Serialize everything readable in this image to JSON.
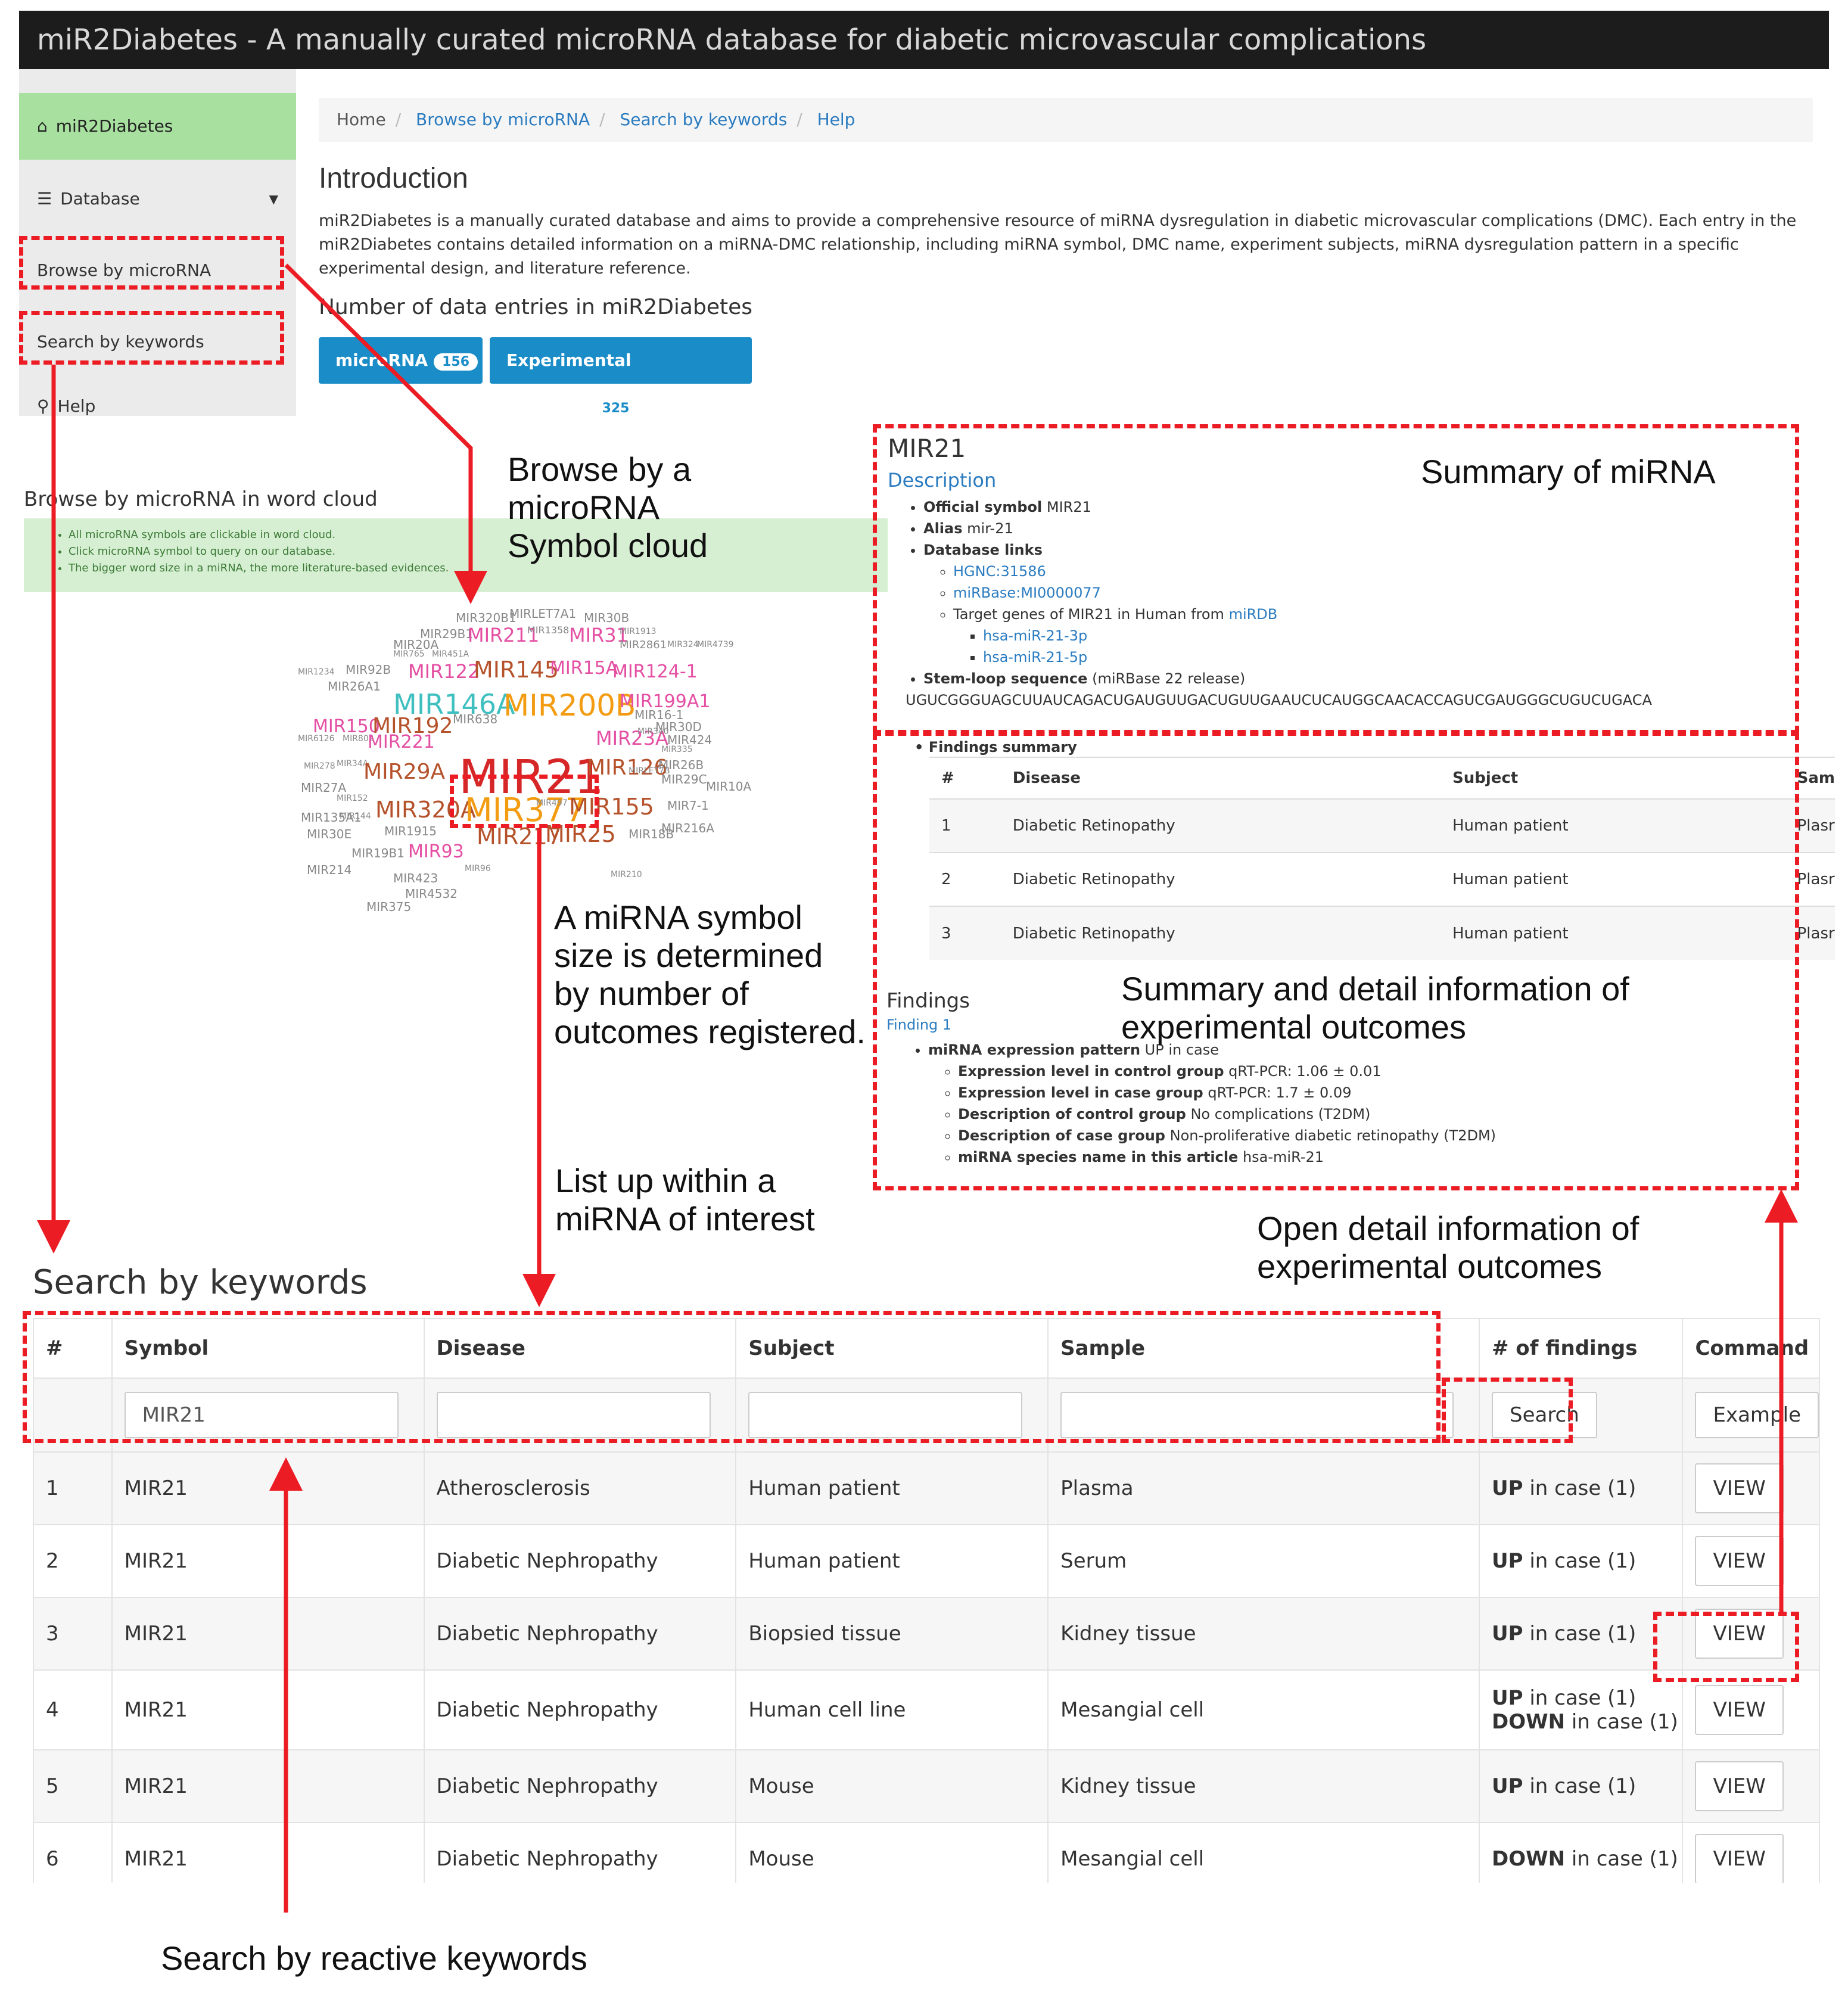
{
  "app_title": "miR2Diabetes - A manually curated microRNA database for diabetic microvascular complications",
  "sidebar": {
    "home_label": "miR2Diabetes",
    "database_label": "Database",
    "browse_label": "Browse by microRNA",
    "search_label": "Search by keywords",
    "help_label": "Help"
  },
  "breadcrumb": [
    "Home",
    "Browse by microRNA",
    "Search by keywords",
    "Help"
  ],
  "intro": {
    "heading": "Introduction",
    "text": "miR2Diabetes is a manually curated database and aims to provide a comprehensive resource of miRNA dysregulation in diabetic microvascular complications (DMC). Each entry in the miR2Diabetes contains detailed information on a miRNA-DMC relationship, including miRNA symbol, DMC name, experiment subjects, miRNA dysregulation pattern in a specific experimental design, and literature reference.",
    "count_heading": "Number of data entries in miR2Diabetes",
    "btn_microrna": "microRNA",
    "btn_microrna_count": "156",
    "btn_outcome": "Experimental outcome",
    "btn_outcome_count": "325"
  },
  "cloud": {
    "heading": "Browse by microRNA in word cloud",
    "notes": [
      "All microRNA symbols are clickable in word cloud.",
      "Click microRNA symbol to query on our database.",
      "The bigger word size in a miRNA, the more literature-based evidences."
    ],
    "words": [
      {
        "t": "MIR320B1",
        "c": "#888"
      },
      {
        "t": "MIRLET7A1",
        "c": "#888"
      },
      {
        "t": "MIR30B",
        "c": "#888"
      },
      {
        "t": "MIR29B1",
        "c": "#888"
      },
      {
        "t": "MIR211",
        "c": "#e44fa3"
      },
      {
        "t": "MIR1358",
        "c": "#888"
      },
      {
        "t": "MIR31",
        "c": "#e44fa3"
      },
      {
        "t": "MIR1913",
        "c": "#888"
      },
      {
        "t": "MIR20A",
        "c": "#888"
      },
      {
        "t": "MIR2861",
        "c": "#888"
      },
      {
        "t": "MIR324",
        "c": "#888"
      },
      {
        "t": "MIR4739",
        "c": "#888"
      },
      {
        "t": "MIR765",
        "c": "#888"
      },
      {
        "t": "MIR451A",
        "c": "#888"
      },
      {
        "t": "MIR1234",
        "c": "#888"
      },
      {
        "t": "MIR92B",
        "c": "#888"
      },
      {
        "t": "MIR122",
        "c": "#e44fa3"
      },
      {
        "t": "MIR145",
        "c": "#b5522b"
      },
      {
        "t": "MIR15A",
        "c": "#e44fa3"
      },
      {
        "t": "MIR124-1",
        "c": "#e44fa3"
      },
      {
        "t": "MIR26A1",
        "c": "#888"
      },
      {
        "t": "MIR146A",
        "c": "#3fbfbf"
      },
      {
        "t": "MIR200B",
        "c": "#f39c12"
      },
      {
        "t": "MIR199A1",
        "c": "#e44fa3"
      },
      {
        "t": "MIR16-1",
        "c": "#888"
      },
      {
        "t": "MIR150",
        "c": "#e44fa3"
      },
      {
        "t": "MIR192",
        "c": "#b5522b"
      },
      {
        "t": "MIR638",
        "c": "#888"
      },
      {
        "t": "MIR30D",
        "c": "#888"
      },
      {
        "t": "MIR6126",
        "c": "#888"
      },
      {
        "t": "MIR802",
        "c": "#888"
      },
      {
        "t": "MIR221",
        "c": "#e44fa3"
      },
      {
        "t": "MIR23A",
        "c": "#e44fa3"
      },
      {
        "t": "MIR340",
        "c": "#888"
      },
      {
        "t": "MIR424",
        "c": "#888"
      },
      {
        "t": "MIR21",
        "c": "#d62728"
      },
      {
        "t": "MIR126",
        "c": "#b5522b"
      },
      {
        "t": "MIR335",
        "c": "#888"
      },
      {
        "t": "MIR278",
        "c": "#888"
      },
      {
        "t": "MIR34A",
        "c": "#888"
      },
      {
        "t": "MIR29A",
        "c": "#b5522b"
      },
      {
        "t": "MIR26B",
        "c": "#888"
      },
      {
        "t": "MIRLET7B",
        "c": "#888"
      },
      {
        "t": "MIR29C",
        "c": "#888"
      },
      {
        "t": "MIR27A",
        "c": "#888"
      },
      {
        "t": "MIR10A",
        "c": "#888"
      },
      {
        "t": "MIR152",
        "c": "#888"
      },
      {
        "t": "MIR320A",
        "c": "#b5522b"
      },
      {
        "t": "MIR377",
        "c": "#f39c12"
      },
      {
        "t": "MIR497",
        "c": "#888"
      },
      {
        "t": "MIR155",
        "c": "#b5522b"
      },
      {
        "t": "MIR7-1",
        "c": "#888"
      },
      {
        "t": "MIR135A1",
        "c": "#888"
      },
      {
        "t": "MIR144",
        "c": "#888"
      },
      {
        "t": "MIR30E",
        "c": "#888"
      },
      {
        "t": "MIR1915",
        "c": "#888"
      },
      {
        "t": "MIR217",
        "c": "#b5522b"
      },
      {
        "t": "MIR25",
        "c": "#b5522b"
      },
      {
        "t": "MIR18B",
        "c": "#888"
      },
      {
        "t": "MIR216A",
        "c": "#888"
      },
      {
        "t": "MIR19B1",
        "c": "#888"
      },
      {
        "t": "MIR93",
        "c": "#e44fa3"
      },
      {
        "t": "MIR214",
        "c": "#888"
      },
      {
        "t": "MIR96",
        "c": "#888"
      },
      {
        "t": "MIR423",
        "c": "#888"
      },
      {
        "t": "MIR210",
        "c": "#888"
      },
      {
        "t": "MIR4532",
        "c": "#888"
      },
      {
        "t": "MIR375",
        "c": "#888"
      }
    ]
  },
  "mirna_summary": {
    "title": "MIR21",
    "description_label": "Description",
    "official_symbol_label": "Official symbol",
    "official_symbol": "MIR21",
    "alias_label": "Alias",
    "alias": "mir-21",
    "db_links_label": "Database links",
    "hgnc": "HGNC:31586",
    "mirbase": "miRBase:MI0000077",
    "target_text": "Target genes of MIR21 in Human from",
    "mirdb": "miRDB",
    "arm3p": "hsa-miR-21-3p",
    "arm5p": "hsa-miR-21-5p",
    "stemloop_label": "Stem-loop sequence",
    "stemloop_note": "(miRBase 22 release)",
    "stemloop_seq": "UGUCGGGUAGCUUAUCAGACUGAUGUUGACUGUUGAAUCUCAUGGCAACACCAGUCGAUGGGCUGUCUGACA"
  },
  "findings_summary": {
    "label": "Findings summary",
    "headers": [
      "#",
      "Disease",
      "Subject",
      "Sam"
    ],
    "rows": [
      [
        "1",
        "Diabetic Retinopathy",
        "Human patient",
        "Plasr"
      ],
      [
        "2",
        "Diabetic Retinopathy",
        "Human patient",
        "Plasr"
      ],
      [
        "3",
        "Diabetic Retinopathy",
        "Human patient",
        "Plasr"
      ]
    ]
  },
  "findings": {
    "heading": "Findings",
    "finding_link": "Finding 1",
    "pattern_label": "miRNA expression pattern",
    "pattern": "UP in case",
    "control_level_label": "Expression level in control group",
    "control_level": "qRT-PCR: 1.06 ± 0.01",
    "case_level_label": "Expression level in case group",
    "case_level": "qRT-PCR: 1.7 ± 0.09",
    "control_desc_label": "Description of control group",
    "control_desc": "No complications (T2DM)",
    "case_desc_label": "Description of case group",
    "case_desc": "Non-proliferative diabetic retinopathy (T2DM)",
    "species_label": "miRNA species name in this article",
    "species": "hsa-miR-21"
  },
  "search": {
    "heading": "Search by keywords",
    "headers": [
      "#",
      "Symbol",
      "Disease",
      "Subject",
      "Sample",
      "# of findings",
      "Command"
    ],
    "symbol_value": "MIR21",
    "search_button": "Search",
    "example_button": "Example",
    "view_label": "VIEW",
    "rows": [
      {
        "n": "1",
        "symbol": "MIR21",
        "disease": "Atherosclerosis",
        "subject": "Human patient",
        "sample": "Plasma",
        "f1b": "UP",
        "f1": " in case (1)",
        "f2b": "",
        "f2": ""
      },
      {
        "n": "2",
        "symbol": "MIR21",
        "disease": "Diabetic Nephropathy",
        "subject": "Human patient",
        "sample": "Serum",
        "f1b": "UP",
        "f1": " in case (1)",
        "f2b": "",
        "f2": ""
      },
      {
        "n": "3",
        "symbol": "MIR21",
        "disease": "Diabetic Nephropathy",
        "subject": "Biopsied tissue",
        "sample": "Kidney tissue",
        "f1b": "UP",
        "f1": " in case (1)",
        "f2b": "",
        "f2": ""
      },
      {
        "n": "4",
        "symbol": "MIR21",
        "disease": "Diabetic Nephropathy",
        "subject": "Human cell line",
        "sample": "Mesangial cell",
        "f1b": "UP",
        "f1": " in case (1)",
        "f2b": "DOWN",
        "f2": " in case (1)"
      },
      {
        "n": "5",
        "symbol": "MIR21",
        "disease": "Diabetic Nephropathy",
        "subject": "Mouse",
        "sample": "Kidney tissue",
        "f1b": "UP",
        "f1": " in case (1)",
        "f2b": "",
        "f2": ""
      },
      {
        "n": "6",
        "symbol": "MIR21",
        "disease": "Diabetic Nephropathy",
        "subject": "Mouse",
        "sample": "Mesangial cell",
        "f1b": "DOWN",
        "f1": " in case (1)",
        "f2b": "",
        "f2": ""
      }
    ]
  },
  "annotations": {
    "browse_cloud": [
      "Browse by a",
      "microRNA",
      "Symbol cloud"
    ],
    "summary_mirna": "Summary of miRNA",
    "symbol_size": [
      "A miRNA symbol",
      "size is determined",
      "by number of",
      "outcomes registered."
    ],
    "summary_detail": [
      "Summary and detail information of",
      "experimental outcomes"
    ],
    "list_up": [
      "List up within a",
      "miRNA of interest"
    ],
    "open_detail": [
      "Open detail information of",
      "experimental outcomes"
    ],
    "reactive": "Search by reactive keywords"
  }
}
